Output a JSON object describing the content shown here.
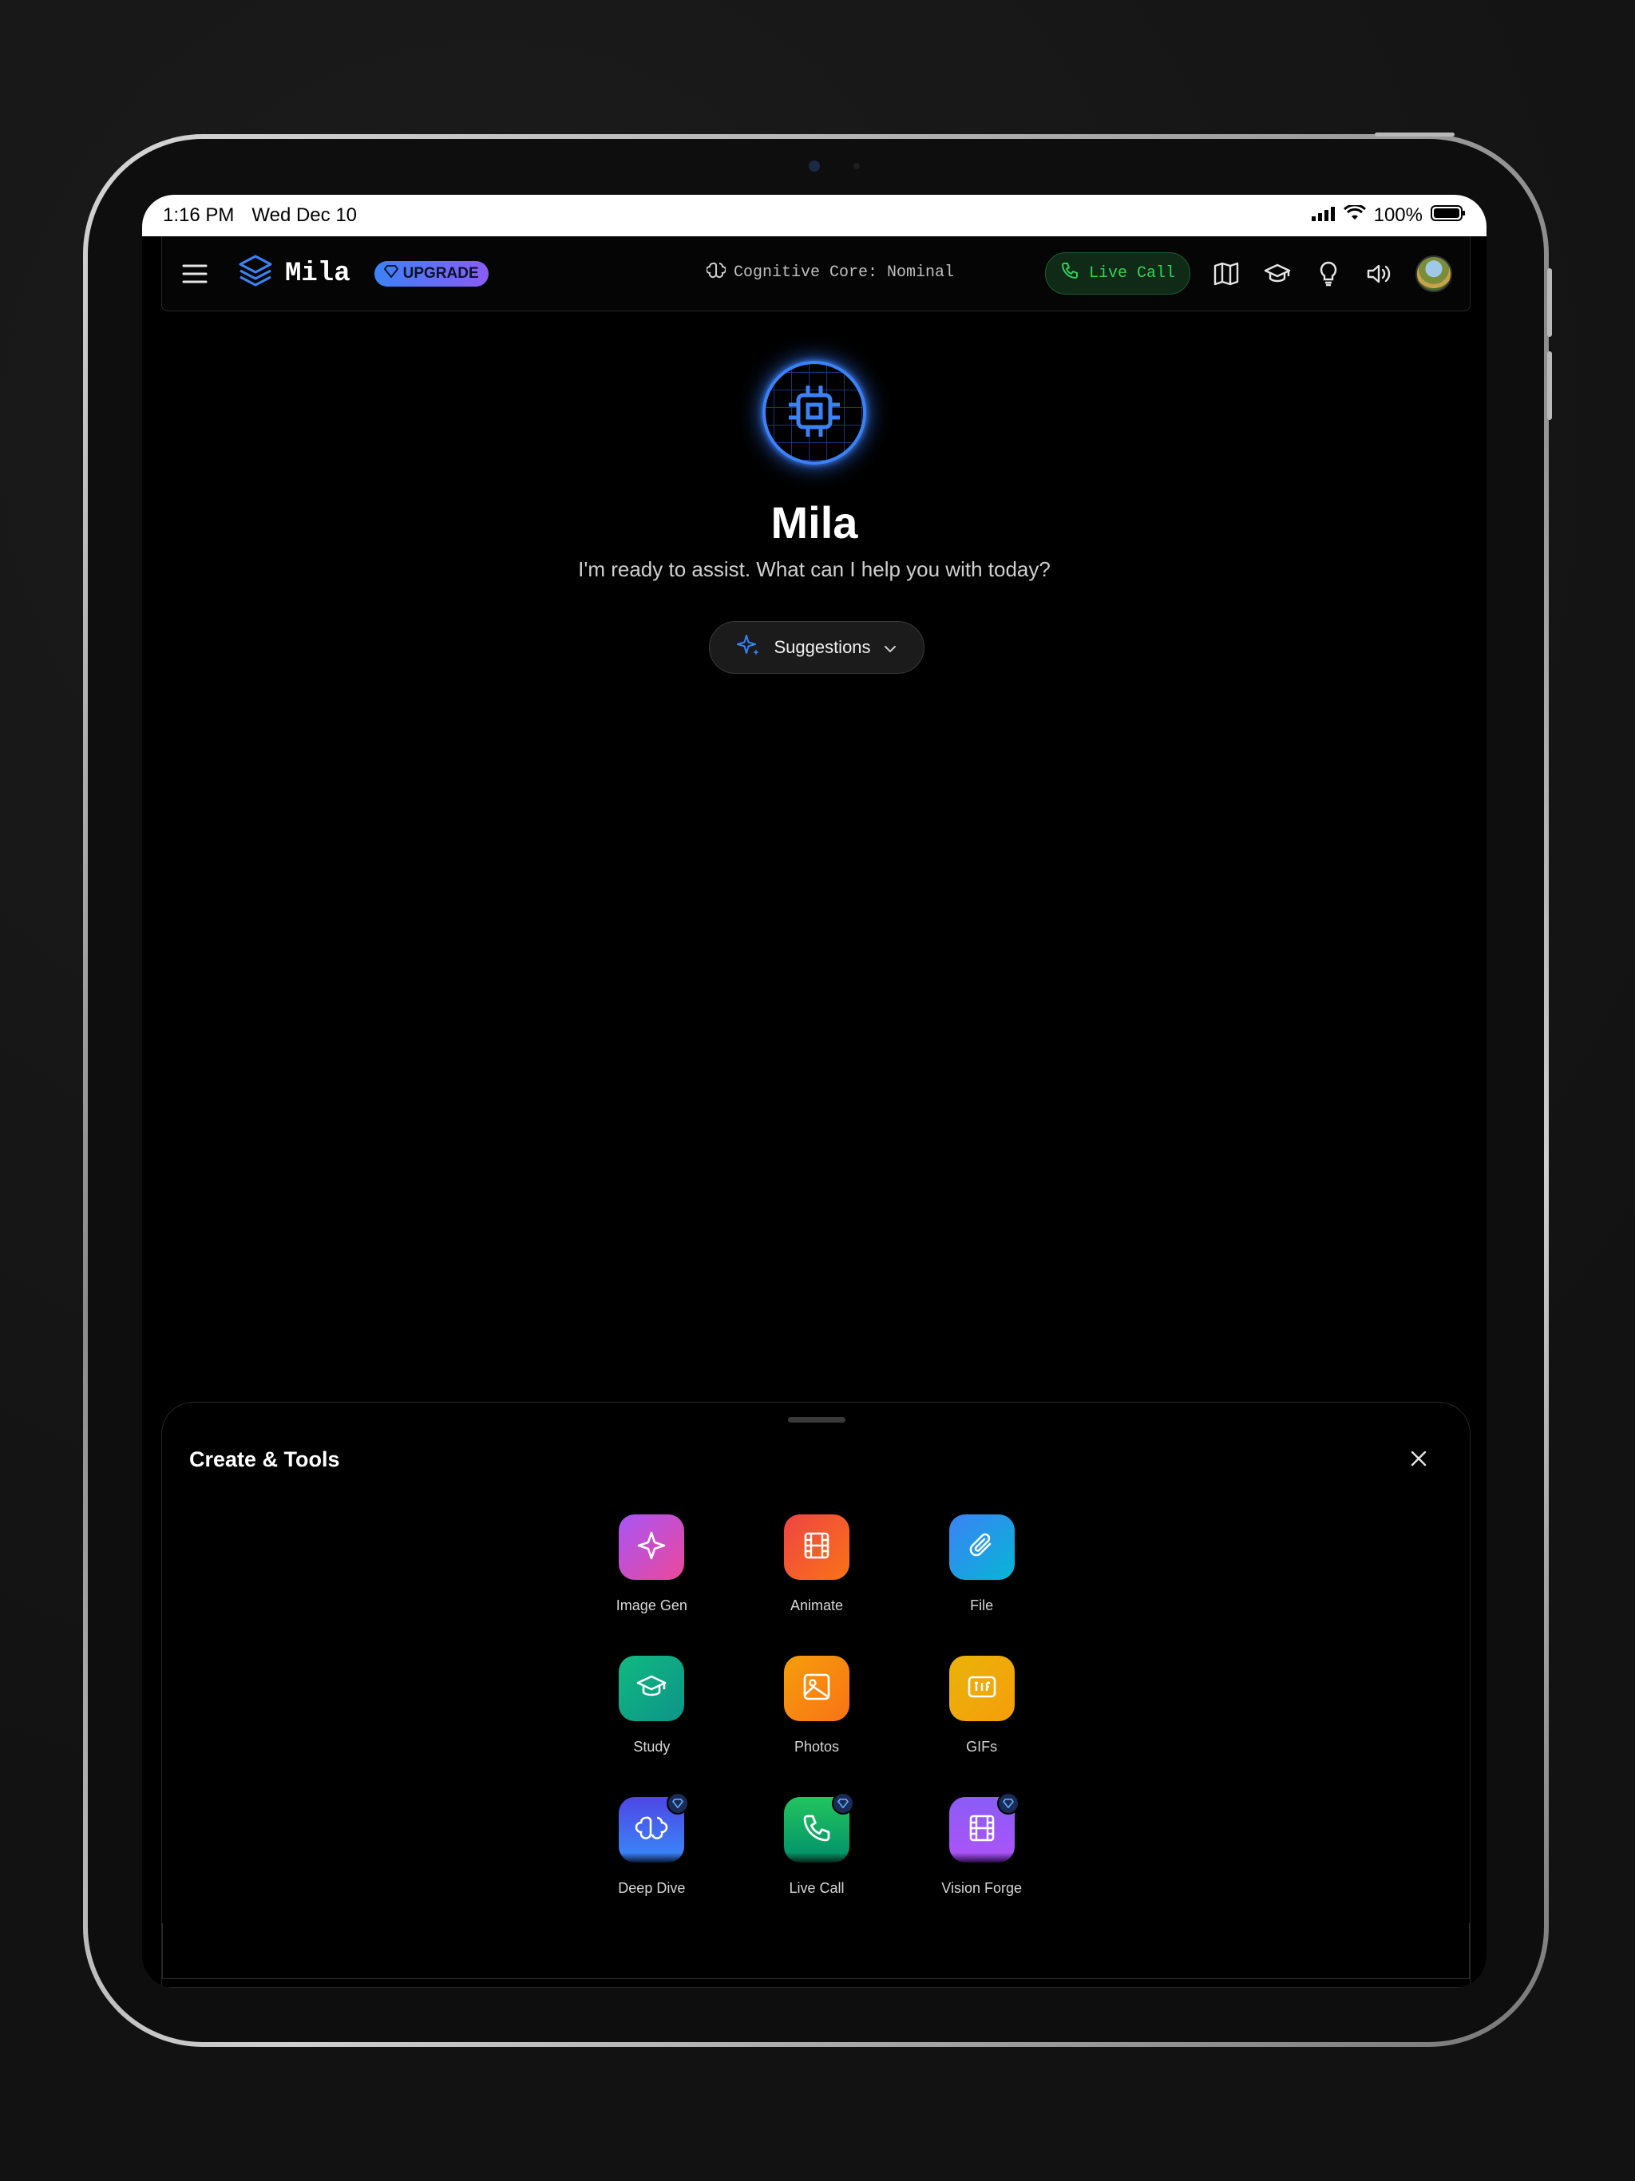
{
  "status_bar": {
    "time": "1:16 PM",
    "date": "Wed Dec 10",
    "battery": "100%"
  },
  "header": {
    "app_name": "Mila",
    "upgrade_label": "UPGRADE",
    "core_status": "Cognitive Core: Nominal",
    "live_call_label": "Live Call",
    "icons": [
      "menu-icon",
      "layers-icon",
      "gem-icon",
      "brain-icon",
      "phone-icon",
      "map-icon",
      "graduation-cap-icon",
      "lightbulb-icon",
      "volume-icon"
    ]
  },
  "hero": {
    "title": "Mila",
    "subtitle": "I'm ready to assist. What can I help you with today?",
    "suggestions_label": "Suggestions"
  },
  "sheet": {
    "title": "Create & Tools",
    "tools": [
      {
        "label": "Image Gen",
        "icon": "sparkle-icon",
        "color_from": "#a855f7",
        "color_to": "#ec4899",
        "premium": false
      },
      {
        "label": "Animate",
        "icon": "film-icon",
        "color_from": "#ef4444",
        "color_to": "#f97316",
        "premium": false
      },
      {
        "label": "File",
        "icon": "paperclip-icon",
        "color_from": "#3b82f6",
        "color_to": "#06b6d4",
        "premium": false
      },
      {
        "label": "Study",
        "icon": "graduation-cap-icon",
        "color_from": "#10b981",
        "color_to": "#0d9488",
        "premium": false
      },
      {
        "label": "Photos",
        "icon": "image-icon",
        "color_from": "#f59e0b",
        "color_to": "#f97316",
        "premium": false
      },
      {
        "label": "GIFs",
        "icon": "gif-icon",
        "color_from": "#eab308",
        "color_to": "#f59e0b",
        "premium": false
      },
      {
        "label": "Deep Dive",
        "icon": "brain-icon",
        "color_from": "#4f46e5",
        "color_to": "#3b82f6",
        "premium": true
      },
      {
        "label": "Live Call",
        "icon": "phone-icon",
        "color_from": "#22c55e",
        "color_to": "#059669",
        "premium": true
      },
      {
        "label": "Vision Forge",
        "icon": "film-icon",
        "color_from": "#8b5cf6",
        "color_to": "#a855f7",
        "premium": true
      }
    ]
  }
}
